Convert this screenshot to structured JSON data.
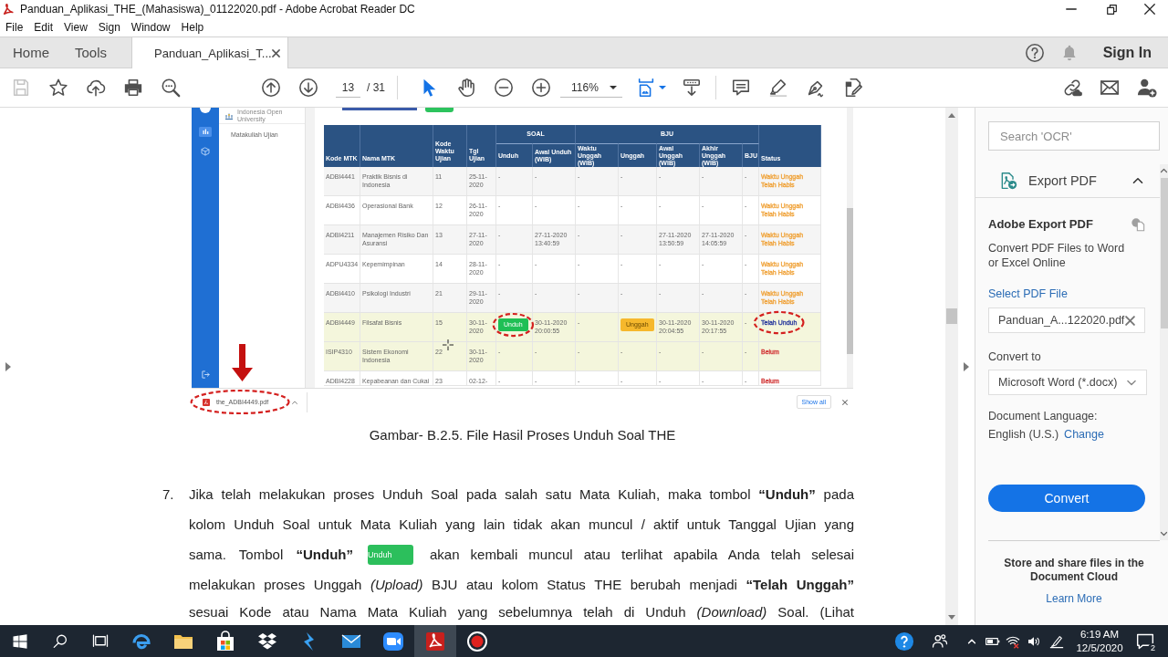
{
  "window": {
    "title": "Panduan_Aplikasi_THE_(Mahasiswa)_01122020.pdf - Adobe Acrobat Reader DC"
  },
  "menu": [
    "File",
    "Edit",
    "View",
    "Sign",
    "Window",
    "Help"
  ],
  "tabs": [
    {
      "label": "Home",
      "kind": "nav",
      "selected": false
    },
    {
      "label": "Tools",
      "kind": "nav",
      "selected": false
    },
    {
      "label": "Panduan_Aplikasi_T...",
      "kind": "document",
      "selected": true
    }
  ],
  "account": {
    "sign_in": "Sign In"
  },
  "toolbar": {
    "file_tools": [
      {
        "kind": "save",
        "disabled": true
      },
      {
        "kind": "bookmark",
        "disabled": false
      },
      {
        "kind": "upload",
        "disabled": false
      },
      {
        "kind": "print",
        "disabled": false
      },
      {
        "kind": "find",
        "disabled": false
      }
    ],
    "page": {
      "current": "13",
      "total": "/ 31"
    },
    "pointer_tools": [
      {
        "kind": "select",
        "selected": true
      },
      {
        "kind": "hand",
        "selected": false
      }
    ],
    "zoom": {
      "value": "116%"
    }
  },
  "document": {
    "figure": {
      "app": {
        "logo_text": "Indonesia Open University",
        "menu": [
          {
            "kind": "chart",
            "selected": true
          },
          {
            "kind": "box",
            "selected": false
          }
        ],
        "nav_item": "Matakuliah Ujian",
        "table": {
          "columns": [
            {
              "label": "Kode MTK",
              "grouped": false
            },
            {
              "label": "Nama MTK",
              "grouped": false
            },
            {
              "label": "Kode Waktu Ujian",
              "grouped": false
            },
            {
              "label": "Tgl Ujian",
              "grouped": false
            },
            {
              "label": "Unduh",
              "grouped": true,
              "group": "SOAL"
            },
            {
              "label": "Awal Unduh (WIB)",
              "grouped": true
            },
            {
              "label": "Waktu Unggah (WIB)",
              "grouped": true,
              "group": "BJU"
            },
            {
              "label": "Unggah",
              "grouped": true
            },
            {
              "label": "Awal Unggah (WIB)",
              "grouped": true
            },
            {
              "label": "Akhir Unggah (WIB)",
              "grouped": true
            },
            {
              "label": "BJU",
              "grouped": true
            },
            {
              "label": "Status",
              "grouped": false
            }
          ],
          "rows": [
            {
              "highlighted": false,
              "cells": [
                "ADBI4441",
                "Praktik Bisnis di Indonesia",
                "11",
                "25-11-2020",
                "-",
                "-",
                "-",
                "-",
                "-",
                "-",
                "-",
                {
                  "kind": "status",
                  "text": "Waktu Unggah Telah Habis",
                  "color": "#f0a33a",
                  "circled": false
                }
              ]
            },
            {
              "highlighted": false,
              "cells": [
                "ADBI4436",
                "Operasional Bank",
                "12",
                "26-11-2020",
                "-",
                "-",
                "-",
                "-",
                "-",
                "-",
                "-",
                {
                  "kind": "status",
                  "text": "Waktu Unggah Telah Habis",
                  "color": "#f0a33a",
                  "circled": false
                }
              ]
            },
            {
              "highlighted": false,
              "cells": [
                "ADBI4211",
                "Manajemen Risiko Dan Asuransi",
                "13",
                "27-11-2020",
                "-",
                "27-11-2020 13:40:59",
                "-",
                "-",
                "27-11-2020 13:50:59",
                "27-11-2020 14:05:59",
                "-",
                {
                  "kind": "status",
                  "text": "Waktu Unggah Telah Habis",
                  "color": "#f0a33a",
                  "circled": false
                }
              ]
            },
            {
              "highlighted": false,
              "cells": [
                "ADPU4334",
                "Kepemimpinan",
                "14",
                "28-11-2020",
                "-",
                "-",
                "-",
                "-",
                "-",
                "-",
                "-",
                {
                  "kind": "status",
                  "text": "Waktu Unggah Telah Habis",
                  "color": "#f0a33a",
                  "circled": false
                }
              ]
            },
            {
              "highlighted": false,
              "cells": [
                "ADBI4410",
                "Psikologi Industri",
                "21",
                "29-11-2020",
                "-",
                "-",
                "-",
                "-",
                "-",
                "-",
                "-",
                {
                  "kind": "status",
                  "text": "Waktu Unggah Telah Habis",
                  "color": "#f0a33a",
                  "circled": false
                }
              ]
            },
            {
              "highlighted": true,
              "cells": [
                "ADBI4449",
                "Filsafat Bisnis",
                "15",
                "30-11-2020",
                {
                  "kind": "button",
                  "text": "Unduh",
                  "color": "#1fbf55",
                  "circled": true
                },
                "30-11-2020 20:00:55",
                "-",
                {
                  "kind": "button",
                  "text": "Unggah",
                  "color": "#f6b82c",
                  "circled": false
                },
                "30-11-2020 20:04:55",
                "30-11-2020 20:17:55",
                "-",
                {
                  "kind": "status",
                  "text": "Telah Unduh",
                  "color": "#2b3c9e",
                  "circled": true
                }
              ]
            },
            {
              "highlighted": true,
              "cells": [
                "ISIP4310",
                "Sistem Ekonomi Indonesia",
                "22",
                "30-11-2020",
                "-",
                "-",
                "-",
                "-",
                "-",
                "-",
                "-",
                {
                  "kind": "status",
                  "text": "Belum",
                  "color": "#d23a3a",
                  "circled": false
                }
              ]
            },
            {
              "highlighted": false,
              "cells": [
                "ADBI4228",
                "Kepabeanan dan Cukai",
                "23",
                "02-12-",
                "-",
                "-",
                "-",
                "-",
                "-",
                "-",
                "-",
                {
                  "kind": "status",
                  "text": "Belum",
                  "color": "#d23a3a",
                  "circled": false
                }
              ]
            }
          ]
        }
      },
      "download": {
        "file": "the_ADBI4449.pdf",
        "circled": true,
        "show_all": "Show all"
      }
    },
    "caption": "Gambar- B.2.5. File Hasil Proses Unduh Soal THE",
    "steps": [
      {
        "number": "7.",
        "lines": [
          {
            "kind": "text",
            "text": "Jika telah melakukan proses Unduh Soal pada salah satu Mata Kuliah, maka tombol **“Unduh”** pada"
          },
          {
            "kind": "text",
            "text": "kolom Unduh Soal untuk Mata Kuliah yang lain tidak akan muncul / aktif untuk Tanggal Ujian yang"
          },
          {
            "kind": "button",
            "text": "sama. Tombol **“Unduh”**",
            "button": "Unduh",
            "text_after": "akan kembali muncul atau terlihat apabila Anda telah selesai"
          },
          {
            "kind": "text",
            "text": "melakukan proses Unggah *(Upload)* BJU atau kolom Status THE berubah menjadi **“Telah Unggah”**"
          },
          {
            "kind": "text",
            "text": "sesuai Kode atau Nama Mata Kuliah yang sebelumnya telah di Unduh *(Download)* Soal. (Lihat"
          }
        ]
      }
    ]
  },
  "export_pane": {
    "search": {
      "placeholder": "Search 'OCR'"
    },
    "section": {
      "title": "Export PDF",
      "expanded": true
    },
    "heading": "Adobe Export PDF",
    "description": "Convert PDF Files to Word or Excel Online",
    "file_label": "Select PDF File",
    "file": {
      "value": "Panduan_A...122020.pdf"
    },
    "format_label": "Convert to",
    "format": {
      "value": "Microsoft Word (*.docx)"
    },
    "language_label": "Document Language:",
    "language": "English (U.S.)",
    "change_link": "Change",
    "convert_button": "Convert",
    "promo": "Store and share files in the Document Cloud",
    "learn_more": "Learn More"
  },
  "taskbar": {
    "pinned": [
      {
        "kind": "browser",
        "active": false
      },
      {
        "kind": "folder",
        "active": false
      },
      {
        "kind": "store",
        "active": false
      },
      {
        "kind": "boxes",
        "active": false
      },
      {
        "kind": "bolt",
        "active": false
      },
      {
        "kind": "mail",
        "active": false
      },
      {
        "kind": "video",
        "active": false
      },
      {
        "kind": "pdf",
        "active": true
      },
      {
        "kind": "record",
        "active": false
      }
    ],
    "clock": {
      "time": "6:19 AM",
      "date": "12/5/2020"
    },
    "notifications": "2"
  }
}
